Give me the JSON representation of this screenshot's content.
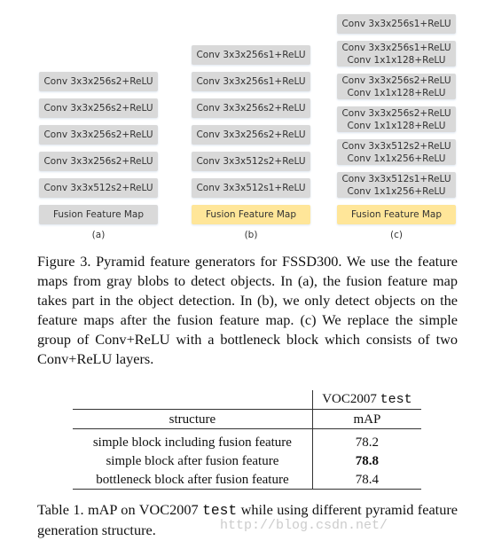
{
  "figure": {
    "columns": [
      {
        "label": "(a)",
        "fusion_highlight": false,
        "blocks": [
          [
            "Conv 3x3x256s2+ReLU"
          ],
          [
            "Conv 3x3x256s2+ReLU"
          ],
          [
            "Conv 3x3x256s2+ReLU"
          ],
          [
            "Conv 3x3x256s2+ReLU"
          ],
          [
            "Conv 3x3x512s2+ReLU"
          ]
        ],
        "fusion": "Fusion Feature Map"
      },
      {
        "label": "(b)",
        "fusion_highlight": true,
        "blocks": [
          [
            "Conv 3x3x256s1+ReLU"
          ],
          [
            "Conv 3x3x256s1+ReLU"
          ],
          [
            "Conv 3x3x256s2+ReLU"
          ],
          [
            "Conv 3x3x256s2+ReLU"
          ],
          [
            "Conv 3x3x512s2+ReLU"
          ],
          [
            "Conv 3x3x512s1+ReLU"
          ]
        ],
        "fusion": "Fusion Feature Map"
      },
      {
        "label": "(c)",
        "fusion_highlight": true,
        "blocks": [
          [
            "Conv 3x3x256s1+ReLU"
          ],
          [
            "Conv 3x3x256s1+ReLU",
            "Conv 1x1x128+ReLU"
          ],
          [
            "Conv 3x3x256s2+ReLU",
            "Conv 1x1x128+ReLU"
          ],
          [
            "Conv 3x3x256s2+ReLU",
            "Conv 1x1x128+ReLU"
          ],
          [
            "Conv 3x3x512s2+ReLU",
            "Conv 1x1x256+ReLU"
          ],
          [
            "Conv 3x3x512s1+ReLU",
            "Conv 1x1x256+ReLU"
          ]
        ],
        "fusion": "Fusion Feature Map"
      }
    ],
    "colors": {
      "gray_blob": "#d9d9d9",
      "fusion_yellow": "#ffe699"
    }
  },
  "figure_caption": "Figure 3. Pyramid feature generators for FSSD300. We use the feature maps from gray blobs to detect objects. In (a), the fusion feature map takes part in the object detection. In (b), we only detect objects on the feature maps after the fusion feature map. (c) We replace the simple group of Conv+ReLU with a bottleneck block which consists of two Conv+ReLU layers.",
  "table": {
    "group_header_text": "VOC2007 ",
    "group_header_code": "test",
    "col_headers": [
      "structure",
      "mAP"
    ],
    "rows": [
      {
        "structure": "simple block including fusion feature",
        "map": "78.2",
        "bold": false
      },
      {
        "structure": "simple block after fusion feature",
        "map": "78.8",
        "bold": true
      },
      {
        "structure": "bottleneck block after fusion feature",
        "map": "78.4",
        "bold": false
      }
    ]
  },
  "table_caption": {
    "a": "Table 1. mAP on VOC2007 ",
    "code": "test",
    "b": " while using different pyramid feature generation structure."
  },
  "watermark": "http://blog.csdn.net/"
}
